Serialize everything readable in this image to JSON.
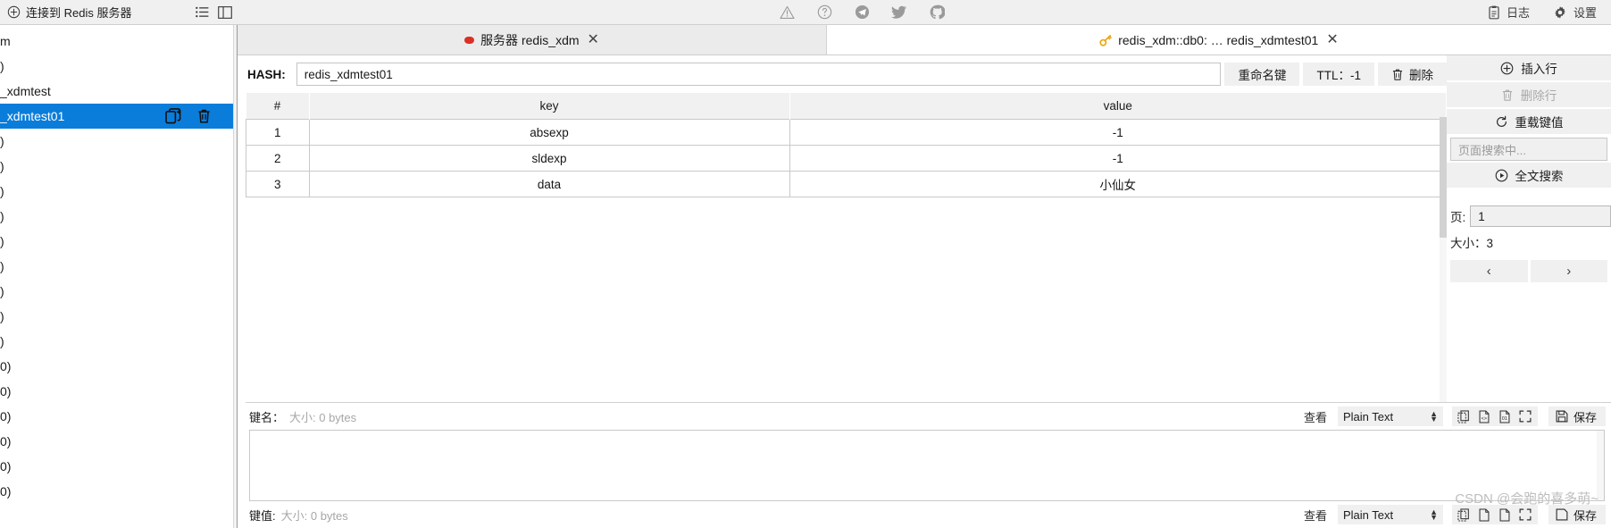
{
  "topbar": {
    "connect_label": "连接到 Redis 服务器",
    "connect_icon": "plus-circle-icon",
    "list_icon": "list-icon",
    "panel_icon": "panel-toggle-icon",
    "social": [
      {
        "name": "warning-icon"
      },
      {
        "name": "help-circle-icon"
      },
      {
        "name": "telegram-icon"
      },
      {
        "name": "twitter-icon"
      },
      {
        "name": "github-icon"
      }
    ],
    "log_label": "日志",
    "log_icon": "clipboard-icon",
    "settings_label": "设置",
    "settings_icon": "gear-icon"
  },
  "sidebar": {
    "items": [
      {
        "label": "m",
        "selected": false
      },
      {
        "label": ")",
        "selected": false
      },
      {
        "label": "_xdmtest",
        "selected": false
      },
      {
        "label": "_xdmtest01",
        "selected": true,
        "actions": [
          "copy-icon",
          "trash-icon"
        ]
      },
      {
        "label": ")",
        "selected": false
      },
      {
        "label": ")",
        "selected": false
      },
      {
        "label": ")",
        "selected": false
      },
      {
        "label": ")",
        "selected": false
      },
      {
        "label": ")",
        "selected": false
      },
      {
        "label": ")",
        "selected": false
      },
      {
        "label": ")",
        "selected": false
      },
      {
        "label": ")",
        "selected": false
      },
      {
        "label": ")",
        "selected": false
      },
      {
        "label": "0)",
        "selected": false
      },
      {
        "label": "0)",
        "selected": false
      },
      {
        "label": "0)",
        "selected": false
      },
      {
        "label": "0)",
        "selected": false
      },
      {
        "label": "0)",
        "selected": false
      },
      {
        "label": "0)",
        "selected": false
      }
    ]
  },
  "tabs": [
    {
      "label": "服务器 redis_xdm",
      "icon": "red-dot-icon",
      "close": "✕",
      "active": false
    },
    {
      "label": "redis_xdm::db0: … redis_xdmtest01",
      "icon": "key-icon",
      "close": "✕",
      "active": true
    }
  ],
  "keyheader": {
    "type_label": "HASH:",
    "key_value": "redis_xdmtest01",
    "rename_label": "重命名键",
    "rename_icon": "",
    "ttl_label": "TTL：-1",
    "delete_label": "删除",
    "delete_icon": "trash-icon"
  },
  "table": {
    "columns": [
      "#",
      "key",
      "value"
    ],
    "rows": [
      {
        "idx": "1",
        "key": "absexp",
        "value": "-1"
      },
      {
        "idx": "2",
        "key": "sldexp",
        "value": "-1"
      },
      {
        "idx": "3",
        "key": "data",
        "value": "小仙女"
      }
    ]
  },
  "rightpanel": {
    "insert_row_label": "插入行",
    "insert_row_icon": "plus-circle-icon",
    "delete_row_label": "删除行",
    "delete_row_icon": "trash-icon",
    "reload_label": "重载键值",
    "reload_icon": "refresh-icon",
    "search_placeholder": "页面搜索中...",
    "fulltext_label": "全文搜索",
    "fulltext_icon": "play-circle-icon",
    "page_label": "页:",
    "page_value": "1",
    "size_label": "大小：3",
    "prev_icon": "‹",
    "next_icon": "›"
  },
  "editors": [
    {
      "name_label": "键名：",
      "size_label": "大小: 0 bytes",
      "view_label": "查看",
      "view_value": "Plain Text",
      "icons": [
        "copy-icon",
        "code-icon",
        "binary-icon",
        "fullscreen-icon"
      ],
      "save_label": "保存",
      "save_icon": "save-icon",
      "content": ""
    },
    {
      "name_label": "键值:",
      "size_label": "大小: 0 bytes",
      "view_label": "查看",
      "view_value": "Plain Text",
      "icons": [
        "copy-icon",
        "code-icon",
        "binary-icon",
        "fullscreen-icon"
      ],
      "save_label": "保存",
      "save_icon": "save-icon",
      "content": ""
    }
  ],
  "watermark": "CSDN @会跑的喜多萌~"
}
